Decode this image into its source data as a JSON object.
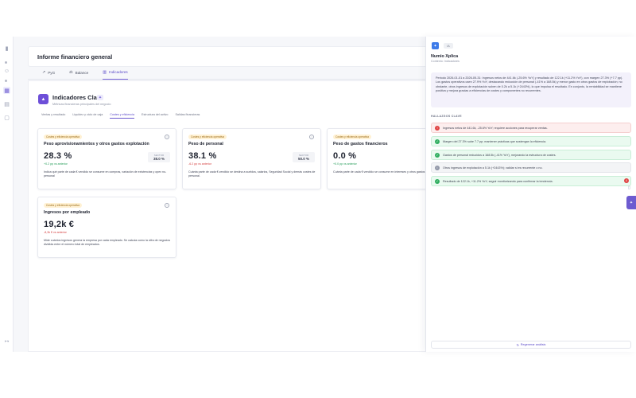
{
  "rail": {
    "icons": [
      "bar-chart-icon",
      "users-icon",
      "grid-icon",
      "table-icon",
      "chat-icon",
      "logout-icon"
    ]
  },
  "header": {
    "title": "Informe financiero general"
  },
  "tabs": [
    {
      "label": "PyG",
      "icon": "trend-icon"
    },
    {
      "label": "Balance",
      "icon": "scale-icon"
    },
    {
      "label": "Indicadores",
      "icon": "chart-icon",
      "active": true
    }
  ],
  "indicators": {
    "title": "Indicadores Clave",
    "subtitle": "Métricas financieras principales del negocio",
    "subtabs": [
      {
        "label": "Ventas y resultado"
      },
      {
        "label": "Liquidez y ciclo de caja"
      },
      {
        "label": "Costes y eficiencia",
        "active": true
      },
      {
        "label": "Estructura del activo"
      },
      {
        "label": "Salidas financieras"
      }
    ]
  },
  "cards": [
    {
      "pill": "Costes y eficiencia operativa",
      "title": "Peso aprovisionamientos y otros gastos explotación",
      "value": "28.3 %",
      "delta": "+0.2 pp vs anterior",
      "delta_kind": "pos",
      "sector_label": "SECTOR",
      "sector_value": "38.0 %",
      "desc": "Indica qué parte de cada € vendido se consume en compras, variación de existencias y opex no-personal"
    },
    {
      "pill": "Costes y eficiencia operativa",
      "title": "Peso de personal",
      "value": "38.1 %",
      "delta": "-6.2 pp vs anterior",
      "delta_kind": "neg",
      "sector_label": "SECTOR",
      "sector_value": "50.0 %",
      "desc": "Cuánta parte de cada € vendido se destina a sueldos, salarios, Seguridad Social y demás costes de personal."
    },
    {
      "pill": "Costes y eficiencia operativa",
      "title": "Peso de gastos financieros",
      "value": "0.0 %",
      "delta": "+0.0 pp vs anterior",
      "delta_kind": "pos",
      "sector_label": "",
      "sector_value": "",
      "desc": "Cuánta parte de cada € vendido se consume en intereses y otros gastos financieros. Refleja apalancamiento y coste del capital frente a la capacidad"
    },
    {
      "pill": "Costes y eficiencia operativa",
      "title": "Ingresos por empleado",
      "value": "19,2k €",
      "delta": "-8,3k € vs anterior",
      "delta_kind": "neg",
      "sector_label": "",
      "sector_value": "",
      "desc": "Mide cuántos ingresos genera la empresa por cada empleado. Se calcula como la cifra de negocios dividida entre el número total de empleados."
    }
  ],
  "panel": {
    "tag": "IA",
    "title": "Numio Xplica",
    "subtitle": "Contexto: Indicadores",
    "summary": "Periodo 2026-01-01 a 2026-05-31: Ingresos netos de 441.6k (-25.6% YoY) y resultado de 122.1k (+11.2% YoY), con margen 27.3% (+7.7 pp). Los gastos operativos caen 27.9% YoY, destacando reducción de personal (-41% a 168.5k) y menor gasto en otros gastos de explotación; no obstante, otros ingresos de explotación suben de 0.2k a 5.1k (+2443%), lo que impulsa el resultado. En conjunto, la rentabilidad se mantiene positiva y mejora gracias a eficiencias de costes y componentes no recurrentes.",
    "section": "HALLAZGOS CLAVE",
    "findings": [
      {
        "kind": "bad",
        "icon": "alert-icon",
        "text": "Ingresos netos de 441.6k, -25.6% YoY; requiere acciones para recuperar ventas."
      },
      {
        "kind": "good",
        "icon": "check-icon",
        "text": "Margen del 27.3% sube 7.7 pp; mantener prácticas que sostengan la eficiencia."
      },
      {
        "kind": "good",
        "icon": "check-icon",
        "text": "Gastos de personal reducidos a 168.5k (-41% YoY), mejorando la estructura de costes."
      },
      {
        "kind": "neutral",
        "icon": "info-icon",
        "text": "Otros ingresos de explotación a 5.1k (+2443%); validar si es recurrente o no."
      },
      {
        "kind": "good",
        "icon": "check-icon",
        "text": "Resultado de 122.1k, +11.2% YoY; seguir monitorizando para confirmar la tendencia."
      }
    ],
    "regen_label": "Regenerar análisis",
    "notif_count": "4"
  }
}
